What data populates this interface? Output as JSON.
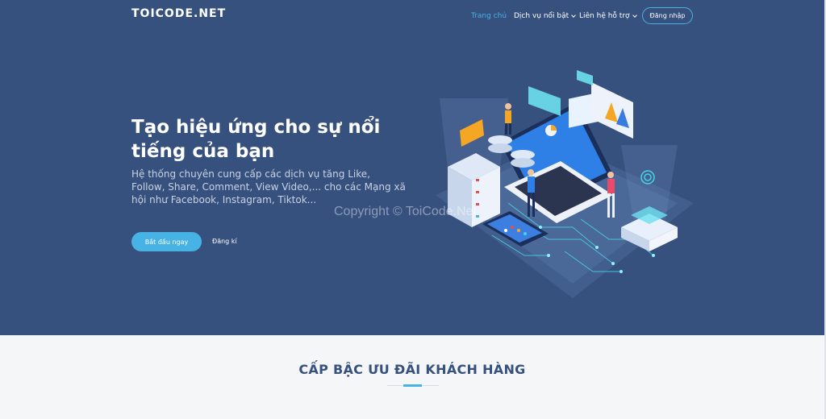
{
  "header": {
    "logo": "TOICODE.NET",
    "nav": [
      {
        "label": "Trang chủ",
        "active": true,
        "dropdown": false
      },
      {
        "label": "Dịch vụ nổi bật",
        "active": false,
        "dropdown": true
      },
      {
        "label": "Liên hệ hỗ trợ",
        "active": false,
        "dropdown": true
      }
    ],
    "login_label": "Đăng nhập"
  },
  "hero": {
    "title": "Tạo hiệu ứng cho sự nổi tiếng của bạn",
    "subtitle": "Hệ thống chuyên cung cấp các dịch vụ tăng Like, Follow, Share, Comment, View Video,... cho các Mạng xã hội như Facebook, Instagram, Tiktok...",
    "cta_label": "Bắt đầu ngay",
    "register_label": "Đăng kí"
  },
  "watermark": "Copyright © ToiCode.Net",
  "section": {
    "title": "CẤP BẬC ƯU ĐÃI KHÁCH HÀNG"
  },
  "colors": {
    "hero_bg": "#37517e",
    "accent": "#47b2e4",
    "section_bg": "#f5f6f8",
    "section_title": "#37517e"
  },
  "icons": [
    "chevron-down-icon",
    "hero-illustration"
  ]
}
